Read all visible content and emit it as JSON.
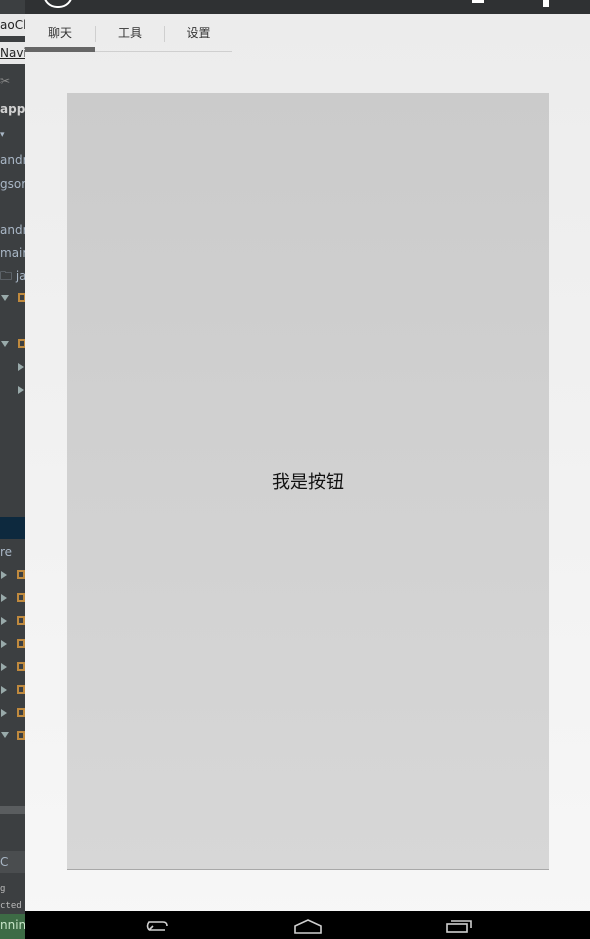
{
  "ide": {
    "rows": [
      "aoCl",
      "Navi",
      "✂",
      "app",
      "▾",
      "andr",
      "gsor",
      "",
      "andr",
      "mair",
      "🗀 ja",
      "re",
      "C",
      "g",
      "cted",
      "nnin"
    ]
  },
  "emulator": {
    "tabs": [
      "聊天",
      "工具",
      "设置"
    ],
    "selected_tab": 0,
    "button_label": "我是按钮"
  }
}
